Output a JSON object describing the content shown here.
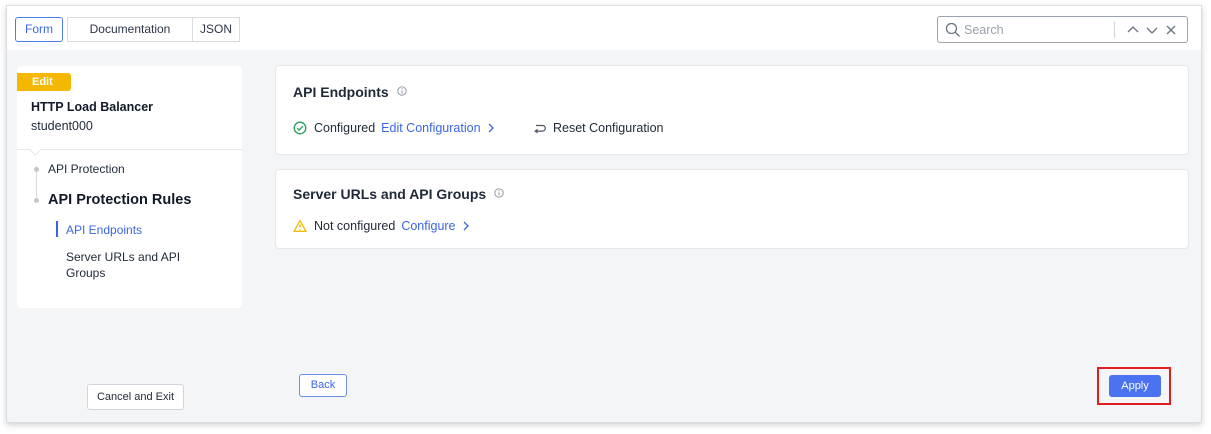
{
  "tabs": [
    {
      "label": "Form"
    },
    {
      "label": "Documentation"
    },
    {
      "label": "JSON"
    }
  ],
  "search": {
    "placeholder": "Search"
  },
  "sidebar": {
    "badge": "Edit",
    "object_type": "HTTP Load Balancer",
    "object_name": "student000",
    "items": [
      {
        "label": "API Protection"
      },
      {
        "label": "API Protection Rules"
      },
      {
        "label": "API Endpoints"
      },
      {
        "label": "Server URLs and API Groups"
      }
    ],
    "cancel_label": "Cancel and Exit"
  },
  "sections": [
    {
      "title": "API Endpoints",
      "status": "Configured",
      "action": "Edit Configuration",
      "secondary_action": "Reset Configuration"
    },
    {
      "title": "Server URLs and API Groups",
      "status": "Not configured",
      "action": "Configure"
    }
  ],
  "footer": {
    "back_label": "Back",
    "apply_label": "Apply"
  },
  "colors": {
    "accent": "#3a66e6",
    "badge": "#f5b800",
    "success": "#22a05a",
    "warning": "#f5b800",
    "highlight": "#e01e1e"
  }
}
